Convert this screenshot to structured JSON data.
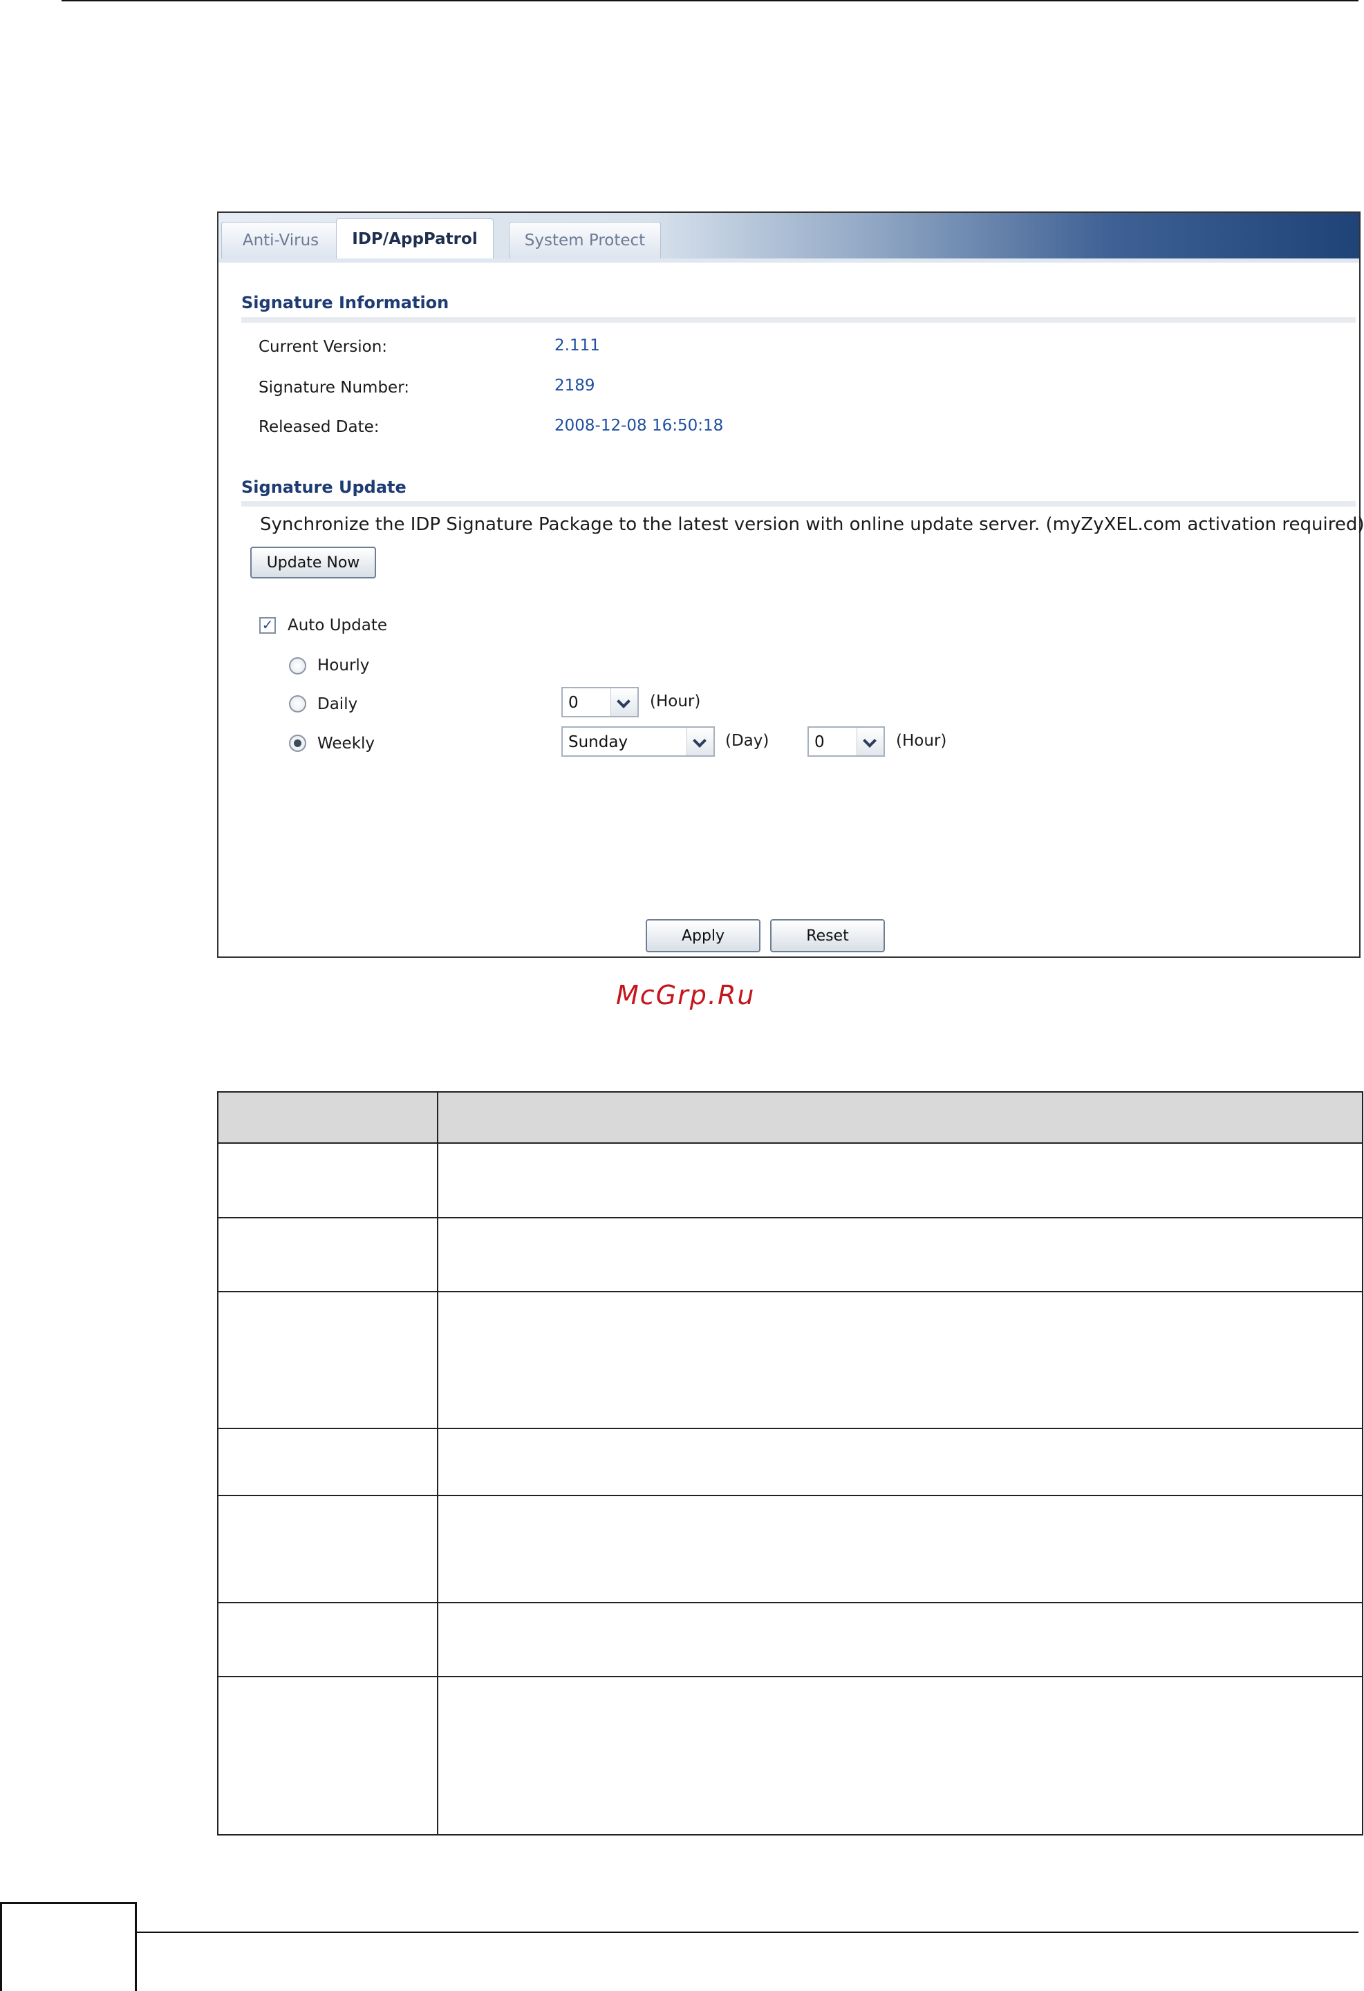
{
  "tabs": [
    {
      "label": "Anti-Virus",
      "active": false
    },
    {
      "label": "IDP/AppPatrol",
      "active": true
    },
    {
      "label": "System Protect",
      "active": false
    }
  ],
  "signature_information": {
    "title": "Signature Information",
    "current_version_label": "Current Version:",
    "current_version_value": "2.111",
    "signature_number_label": "Signature Number:",
    "signature_number_value": "2189",
    "released_date_label": "Released Date:",
    "released_date_value": "2008-12-08 16:50:18"
  },
  "signature_update": {
    "title": "Signature Update",
    "sync_text": "Synchronize the IDP Signature Package to the latest version with online update server.  (myZyXEL.com activation required)",
    "update_now_label": "Update Now",
    "auto_update_label": "Auto Update",
    "auto_update_checked": true,
    "hourly_label": "Hourly",
    "daily_label": "Daily",
    "weekly_label": "Weekly",
    "selected_schedule": "Weekly",
    "daily_hour_value": "0",
    "hour_unit": "(Hour)",
    "weekly_day_value": "Sunday",
    "day_unit": "(Day)",
    "weekly_hour_value": "0"
  },
  "actions": {
    "apply_label": "Apply",
    "reset_label": "Reset"
  },
  "watermark": "McGrp.Ru"
}
